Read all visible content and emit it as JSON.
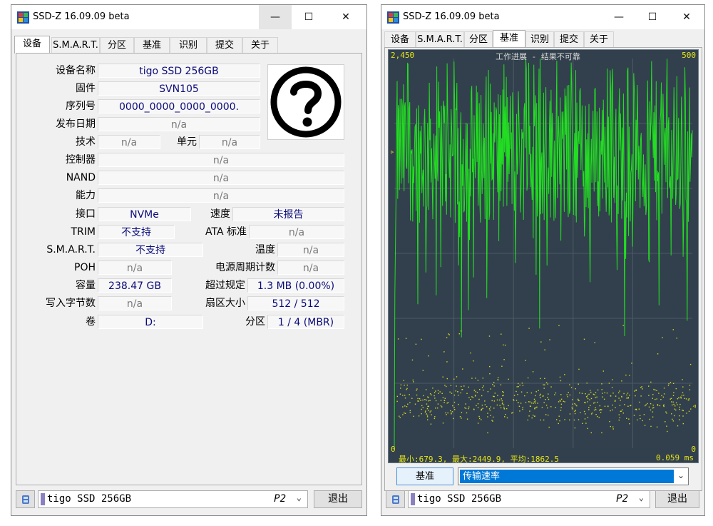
{
  "left_window": {
    "title": "SSD-Z 16.09.09 beta",
    "controls": {
      "minimize": "—",
      "maximize": "☐",
      "close": "✕"
    },
    "tabs": [
      "设备",
      "S.M.A.R.T.",
      "分区",
      "基准",
      "识别",
      "提交",
      "关于"
    ],
    "active_tab": "设备",
    "device_image": "question-mark-icon",
    "fields": {
      "device_name": {
        "label": "设备名称",
        "value": "tigo SSD 256GB"
      },
      "firmware": {
        "label": "固件",
        "value": "SVN105"
      },
      "serial": {
        "label": "序列号",
        "value": "0000_0000_0000_0000."
      },
      "release_date": {
        "label": "发布日期",
        "value": "n/a"
      },
      "technology": {
        "label": "技术",
        "value": "n/a"
      },
      "cell": {
        "label": "单元",
        "value": "n/a"
      },
      "controller": {
        "label": "控制器",
        "value": "n/a"
      },
      "nand": {
        "label": "NAND",
        "value": "n/a"
      },
      "capability": {
        "label": "能力",
        "value": "n/a"
      },
      "interface": {
        "label": "接口",
        "value": "NVMe"
      },
      "speed": {
        "label": "速度",
        "value": "未报告"
      },
      "trim": {
        "label": "TRIM",
        "value": "不支持"
      },
      "ata_standard": {
        "label": "ATA 标准",
        "value": "n/a"
      },
      "smart": {
        "label": "S.M.A.R.T.",
        "value": "不支持"
      },
      "temperature": {
        "label": "温度",
        "value": "n/a"
      },
      "poh": {
        "label": "POH",
        "value": "n/a"
      },
      "power_cycles": {
        "label": "电源周期计数",
        "value": "n/a"
      },
      "capacity": {
        "label": "容量",
        "value": "238.47 GB"
      },
      "over_provisioning": {
        "label": "超过规定",
        "value": "1.3 MB (0.00%)"
      },
      "bytes_written": {
        "label": "写入字节数",
        "value": "n/a"
      },
      "sector_size": {
        "label": "扇区大小",
        "value": "512 / 512"
      },
      "volume": {
        "label": "卷",
        "value": "D:"
      },
      "partition": {
        "label": "分区",
        "value": "1 / 4 (MBR)"
      }
    },
    "drive_select": {
      "name": "tigo SSD 256GB",
      "port": "P2",
      "chevron": "⌄"
    },
    "exit_label": "退出"
  },
  "right_window": {
    "title": "SSD-Z 16.09.09 beta",
    "controls": {
      "minimize": "—",
      "maximize": "☐",
      "close": "✕"
    },
    "tabs": [
      "设备",
      "S.M.A.R.T.",
      "分区",
      "基准",
      "识别",
      "提交",
      "关于"
    ],
    "active_tab": "基准",
    "benchmark": {
      "top_left": "2,450",
      "top_right": "500",
      "header": "工作进展 - 结果不可靠",
      "bottom_left": "0",
      "bottom_right": "0",
      "stats": "最小:679.3, 最大:2449.9, 平均:1862.5",
      "latency": "0.059 ms",
      "left_marker": "▹",
      "right_marker": "◃"
    },
    "bench_button": "基准",
    "mode_select": {
      "value": "传输速率",
      "chevron": "⌄"
    },
    "drive_select": {
      "name": "tigo SSD 256GB",
      "port": "P2",
      "chevron": "⌄"
    },
    "exit_label": "退出"
  },
  "chart_data": {
    "type": "line",
    "title": "工作进展 - 结果不可靠",
    "series": [
      {
        "name": "",
        "color": "#22dd22",
        "min": 679.3,
        "max": 2449.9,
        "mean": 1862.5
      },
      {
        "name": "",
        "color": "#d8d820",
        "style": "dots",
        "ms_range": [
          0,
          200
        ]
      }
    ],
    "ylim_left": [
      0,
      2450
    ],
    "ylim_right": [
      0,
      500
    ],
    "xlabel": "",
    "ylabel": "",
    "grid": true
  }
}
